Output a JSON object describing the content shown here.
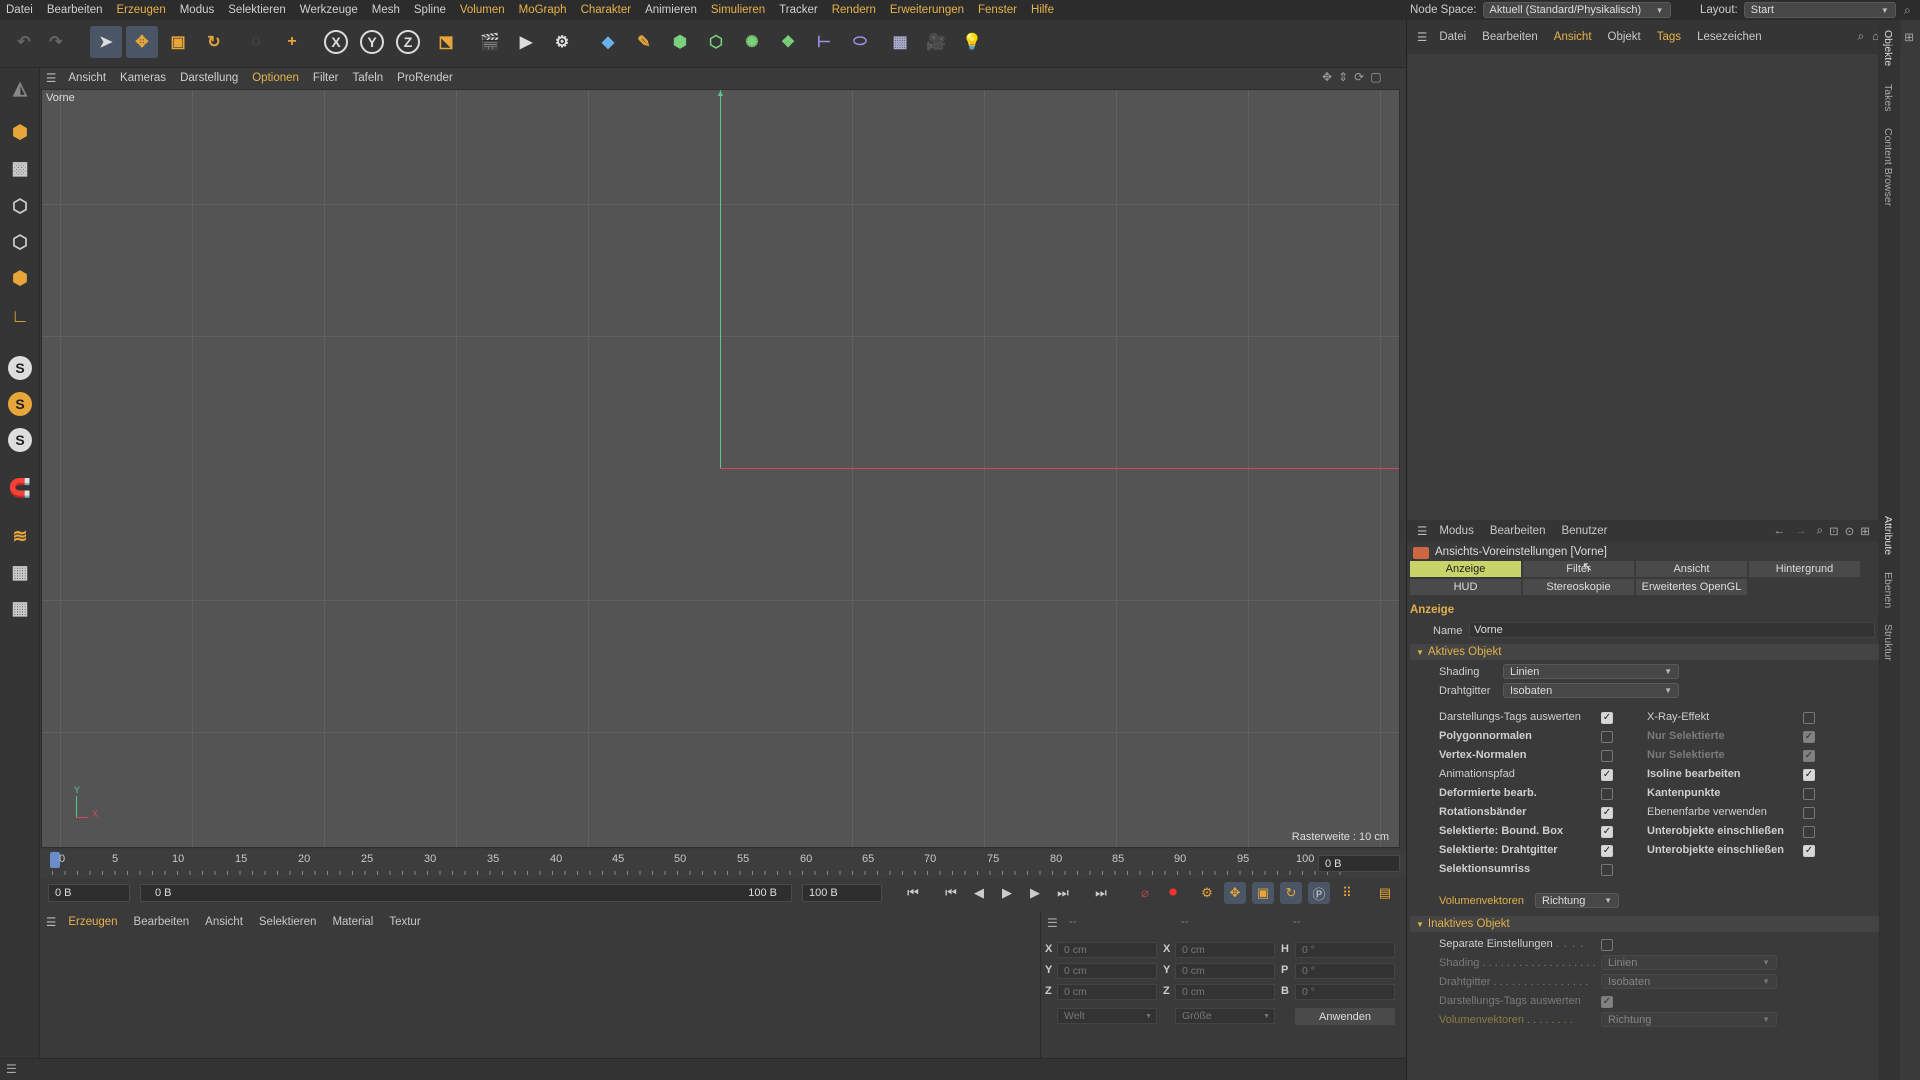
{
  "menu": [
    "Datei",
    "Bearbeiten",
    "Erzeugen",
    "Modus",
    "Selektieren",
    "Werkzeuge",
    "Mesh",
    "Spline",
    "Volumen",
    "MoGraph",
    "Charakter",
    "Animieren",
    "Simulieren",
    "Tracker",
    "Rendern",
    "Erweiterungen",
    "Fenster",
    "Hilfe"
  ],
  "nodespace": {
    "label": "Node Space:",
    "value": "Aktuell (Standard/Physikalisch)"
  },
  "layout": {
    "label": "Layout:",
    "value": "Start"
  },
  "toolbar": {
    "x": "X",
    "y": "Y",
    "z": "Z"
  },
  "leftbar": {
    "s": "S"
  },
  "viewport_menu": [
    "Ansicht",
    "Kameras",
    "Darstellung",
    "Optionen",
    "Filter",
    "Tafeln",
    "ProRender"
  ],
  "viewport": {
    "name": "Vorne",
    "grid": "Rasterweite : 10 cm",
    "axis_y": "Y",
    "axis_x": "X"
  },
  "timeline": {
    "ticks": [
      "0",
      "5",
      "10",
      "15",
      "20",
      "25",
      "30",
      "35",
      "40",
      "45",
      "50",
      "55",
      "60",
      "65",
      "70",
      "75",
      "80",
      "85",
      "90",
      "95",
      "100"
    ],
    "current": "0 B",
    "start": "0 B",
    "range_start": "0 B",
    "range_end": "100 B",
    "end": "100 B"
  },
  "material_menu": [
    "Erzeugen",
    "Bearbeiten",
    "Ansicht",
    "Selektieren",
    "Material",
    "Textur"
  ],
  "coords": {
    "header": [
      "--",
      "--",
      "--"
    ],
    "labels": [
      "X",
      "Y",
      "Z"
    ],
    "pos": [
      "0 cm",
      "0 cm",
      "0 cm"
    ],
    "size": [
      "0 cm",
      "0 cm",
      "0 cm"
    ],
    "rot_labels": [
      "H",
      "P",
      "B"
    ],
    "rot": [
      "0 °",
      "0 °",
      "0 °"
    ],
    "mode1": "Welt",
    "mode2": "Größe",
    "apply": "Anwenden"
  },
  "objects_menu": [
    "Datei",
    "Bearbeiten",
    "Ansicht",
    "Objekt",
    "Tags",
    "Lesezeichen"
  ],
  "vtabs": [
    "Objekte",
    "Takes",
    "Content Browser",
    "Attribute",
    "Ebenen",
    "Struktur"
  ],
  "attr_menu": [
    "Modus",
    "Bearbeiten",
    "Benutzer"
  ],
  "attr": {
    "title": "Ansichts-Voreinstellungen [Vorne]",
    "tabs1": [
      "Anzeige",
      "Filter",
      "Ansicht",
      "Hintergrund"
    ],
    "tabs2": [
      "HUD",
      "Stereoskopie",
      "Erweitertes OpenGL"
    ],
    "section": "Anzeige",
    "name_label": "Name",
    "name_value": "Vorne",
    "active": "Aktives Objekt",
    "shading_label": "Shading",
    "shading_value": "Linien",
    "wire_label": "Drahtgitter",
    "wire_value": "Isobaten",
    "left_items": [
      {
        "label": "Darstellungs-Tags auswerten",
        "bold": false,
        "checked": true
      },
      {
        "label": "Polygonnormalen",
        "bold": true,
        "checked": false
      },
      {
        "label": "Vertex-Normalen",
        "bold": true,
        "checked": false
      },
      {
        "label": "Animationspfad",
        "bold": false,
        "checked": true
      },
      {
        "label": "Deformierte bearb.",
        "bold": true,
        "checked": false
      },
      {
        "label": "Rotationsbänder",
        "bold": true,
        "checked": true
      },
      {
        "label": "Selektierte: Bound. Box",
        "bold": true,
        "checked": true
      },
      {
        "label": "Selektierte: Drahtgitter",
        "bold": true,
        "checked": true
      },
      {
        "label": "Selektionsumriss",
        "bold": true,
        "checked": false
      }
    ],
    "right_items": [
      {
        "label": "X-Ray-Effekt",
        "bold": false,
        "checked": false,
        "dim": false
      },
      {
        "label": "Nur Selektierte",
        "bold": true,
        "checked": true,
        "dim": true
      },
      {
        "label": "Nur Selektierte",
        "bold": true,
        "checked": true,
        "dim": true
      },
      {
        "label": "Isoline bearbeiten",
        "bold": true,
        "checked": true,
        "dim": false
      },
      {
        "label": "Kantenpunkte",
        "bold": true,
        "checked": false,
        "dim": false
      },
      {
        "label": "Ebenenfarbe verwenden",
        "bold": false,
        "checked": false,
        "dim": false
      },
      {
        "label": "Unterobjekte einschließen",
        "bold": true,
        "checked": false,
        "dim": false
      },
      {
        "label": "Unterobjekte einschließen",
        "bold": true,
        "checked": true,
        "dim": false
      }
    ],
    "vol_label": "Volumenvektoren",
    "vol_value": "Richtung",
    "inactive": "Inaktives Objekt",
    "sep_label": "Separate Einstellungen",
    "in_shading_label": "Shading",
    "in_shading_value": "Linien",
    "in_wire_label": "Drahtgitter",
    "in_wire_value": "Isobaten",
    "in_tags_label": "Darstellungs-Tags auswerten",
    "in_vol_label": "Volumenvektoren",
    "in_vol_value": "Richtung"
  }
}
